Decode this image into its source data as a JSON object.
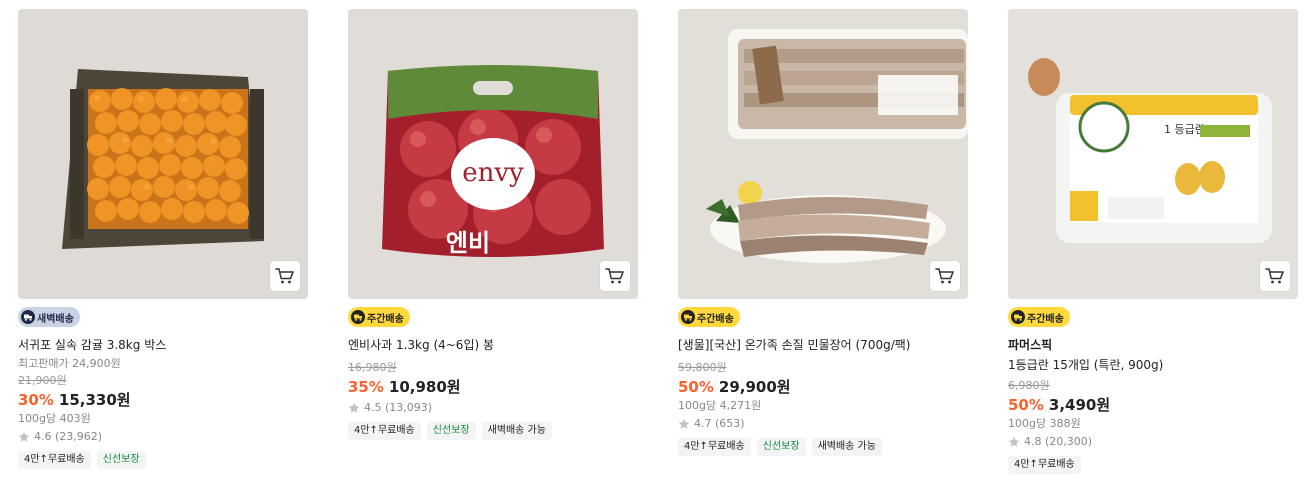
{
  "colors": {
    "discount": "#fa622f",
    "dawn_badge": "#c9d3e4",
    "weekly_badge": "#ffd83b",
    "fresh_tag_text": "#0f8a3d"
  },
  "products": [
    {
      "badge": "새벽배송",
      "badge_type": "dawn",
      "title": "서귀포 실속 감귤 3.8kg 박스",
      "sub": "최고판매가 24,900원",
      "original_price": "21,900원",
      "discount": "30%",
      "price": "15,330원",
      "unit_price": "100g당 403원",
      "rating": "4.6 (23,962)",
      "tags": [
        "4만↑무료배송",
        "신선보장"
      ],
      "image_icon": "tangerine-box-image"
    },
    {
      "badge": "주간배송",
      "badge_type": "weekly",
      "title": "엔비사과 1.3kg (4~6입) 봉",
      "original_price": "16,980원",
      "discount": "35%",
      "price": "10,980원",
      "rating": "4.5 (13,093)",
      "tags": [
        "4만↑무료배송",
        "신선보장",
        "새벽배송 가능"
      ],
      "image_icon": "envy-apple-bag-image",
      "image_text": {
        "logo": "envy",
        "korean": "엔비"
      }
    },
    {
      "badge": "주간배송",
      "badge_type": "weekly",
      "title": "[생물][국산] 온가족 손질 민물장어 (700g/팩)",
      "original_price": "59,800원",
      "discount": "50%",
      "price": "29,900원",
      "unit_price": "100g당 4,271원",
      "rating": "4.7 (653)",
      "tags": [
        "4만↑무료배송",
        "신선보장",
        "새벽배송 가능"
      ],
      "image_icon": "eel-package-image"
    },
    {
      "badge": "주간배송",
      "badge_type": "weekly",
      "brand": "파머스픽",
      "title": "1등급란 15개입 (특란, 900g)",
      "original_price": "6,980원",
      "discount": "50%",
      "price": "3,490원",
      "unit_price": "100g당 388원",
      "rating": "4.8 (20,300)",
      "tags": [
        "4만↑무료배송"
      ],
      "image_icon": "egg-carton-image",
      "image_text": {
        "label": "1 등급란"
      }
    }
  ]
}
